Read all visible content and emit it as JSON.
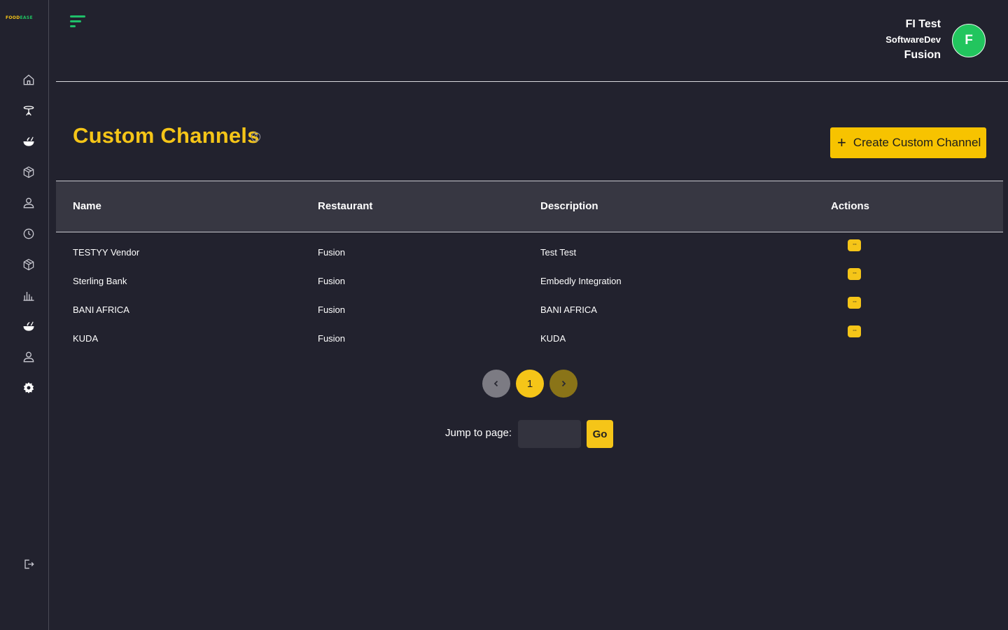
{
  "brand": {
    "part1": "FOOD",
    "part2": "EASE"
  },
  "sidebar": {
    "items": [
      {
        "icon": "home-icon"
      },
      {
        "icon": "table-icon"
      },
      {
        "icon": "food-bowl-icon"
      },
      {
        "icon": "box-icon"
      },
      {
        "icon": "user-icon"
      },
      {
        "icon": "clock-icon"
      },
      {
        "icon": "package-icon"
      },
      {
        "icon": "bar-chart-icon"
      },
      {
        "icon": "food-bowl-icon"
      },
      {
        "icon": "user-icon"
      },
      {
        "icon": "gear-icon"
      }
    ],
    "logout_icon": "logout-icon"
  },
  "user": {
    "name": "FI Test",
    "role": "SoftwareDev",
    "org": "Fusion",
    "initial": "F"
  },
  "page": {
    "title": "Custom Channels",
    "create_label": "Create Custom Channel"
  },
  "table": {
    "headers": {
      "name": "Name",
      "restaurant": "Restaurant",
      "description": "Description",
      "actions": "Actions"
    },
    "rows": [
      {
        "name": "TESTYY Vendor",
        "restaurant": "Fusion",
        "description": "Test Test"
      },
      {
        "name": "Sterling Bank",
        "restaurant": "Fusion",
        "description": "Embedly Integration"
      },
      {
        "name": "BANI AFRICA",
        "restaurant": "Fusion",
        "description": "BANI AFRICA"
      },
      {
        "name": "KUDA",
        "restaurant": "Fusion",
        "description": "KUDA"
      }
    ],
    "action_glyph": "···"
  },
  "pagination": {
    "current": "1",
    "jump_label": "Jump to page:",
    "go_label": "Go"
  },
  "colors": {
    "accent": "#f5c518",
    "avatar": "#22c55e",
    "background": "#22222e",
    "header_bg": "#373742"
  }
}
